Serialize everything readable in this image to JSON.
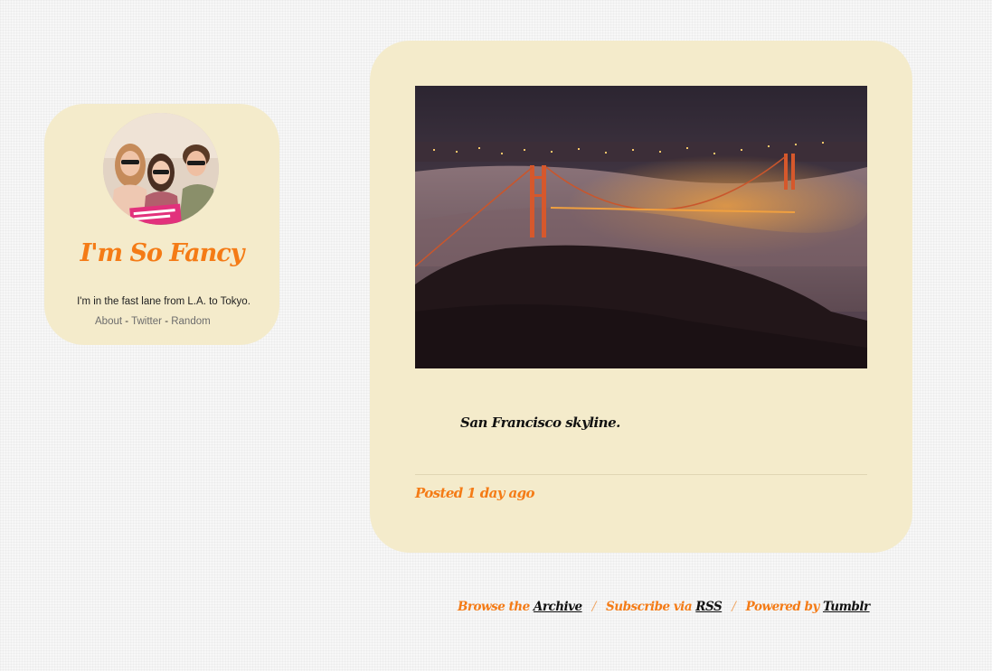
{
  "sidebar": {
    "title": "I'm So Fancy",
    "description": "I'm in the fast lane from L.A. to Tokyo.",
    "links": [
      {
        "label": "About"
      },
      {
        "label": "Twitter"
      },
      {
        "label": "Random"
      }
    ],
    "separator": "-"
  },
  "post": {
    "caption": "San Francisco skyline.",
    "posted": "Posted 1 day ago"
  },
  "footer": {
    "browse_prefix": "Browse the",
    "archive_label": "Archive",
    "subscribe_prefix": "Subscribe via",
    "rss_label": "RSS",
    "powered_prefix": "Powered by",
    "tumblr_label": "Tumblr",
    "separator": "/"
  },
  "colors": {
    "accent": "#f47b16",
    "card_background": "#f4ebcb",
    "page_background": "#f7f7f7"
  }
}
